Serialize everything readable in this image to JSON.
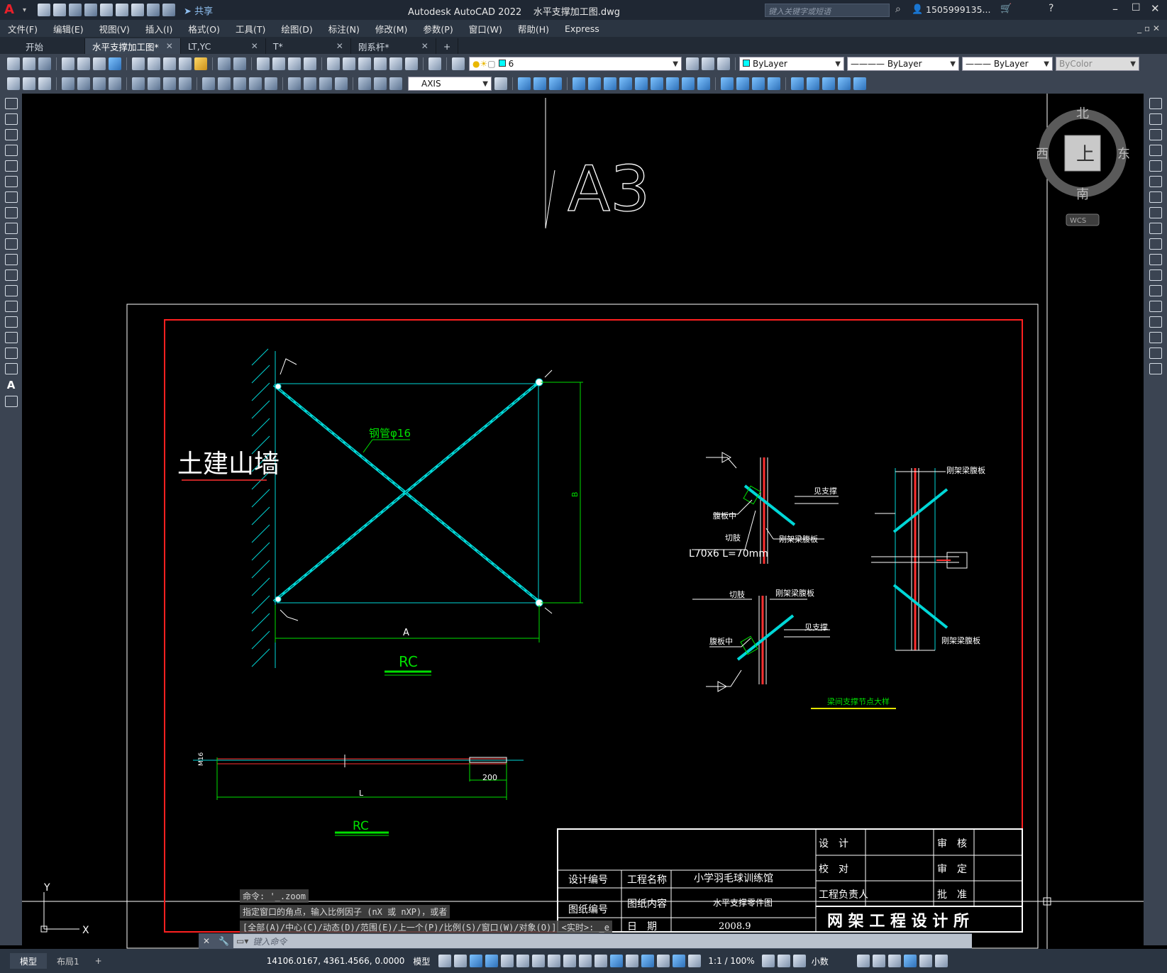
{
  "app": {
    "title": "Autodesk AutoCAD 2022",
    "document": "水平支撑加工图.dwg",
    "share_label": "共享",
    "search_placeholder": "键入关键字或短语",
    "user": "1505999135..."
  },
  "menu": [
    "文件(F)",
    "编辑(E)",
    "视图(V)",
    "插入(I)",
    "格式(O)",
    "工具(T)",
    "绘图(D)",
    "标注(N)",
    "修改(M)",
    "参数(P)",
    "窗口(W)",
    "帮助(H)",
    "Express"
  ],
  "tabs": [
    {
      "label": "开始",
      "closable": false
    },
    {
      "label": "水平支撑加工图*",
      "closable": true,
      "active": true
    },
    {
      "label": "LT,YC",
      "closable": true
    },
    {
      "label": "T*",
      "closable": true
    },
    {
      "label": "刚系杆*",
      "closable": true
    }
  ],
  "toolbar": {
    "layer_value": "6",
    "color_value": "ByLayer",
    "linetype_value": "ByLayer",
    "lineweight_value": "ByLayer",
    "plotstyle_value": "ByColor",
    "textstyle_value": "AXIS"
  },
  "viewcube": {
    "north": "北",
    "south": "南",
    "east": "东",
    "west": "西",
    "face": "上",
    "wcs": "WCS"
  },
  "drawing": {
    "sheet_label": "A3",
    "wall_label": "土建山墙",
    "pipe_label": "钢管φ16",
    "dim_a": "A",
    "dim_b": "B",
    "rc_label_1": "RC",
    "rc_label_2": "RC",
    "rod_dim_200": "200",
    "rod_dim_l": "L",
    "rod_end_label": "M16",
    "detail_labels": {
      "see_brace_1": "见支撑",
      "web_center_1": "腹板中",
      "cut_corner_1": "切肢",
      "frame_beam_web_1": "刚架梁腹板",
      "angle_label": "L70x6 L=70mm",
      "cut_corner_2": "切肢",
      "frame_beam_web_2": "刚架梁腹板",
      "see_brace_2": "见支撑",
      "web_center_2": "腹板中",
      "frame_beam_web_3": "刚架梁腹板",
      "frame_beam_web_4": "刚架梁腹板",
      "detail_title": "梁间支撑节点大样"
    },
    "titleblock": {
      "design": "设　计",
      "review": "审　核",
      "check": "校　对",
      "approve_set": "审　定",
      "project_lead": "工程负责人",
      "ratify": "批　准",
      "design_no": "设计编号",
      "project_name_label": "工程名称",
      "project_name": "小学羽毛球训练馆",
      "drawing_no": "图纸编号",
      "drawing_content_label": "图纸内容",
      "drawing_content": "水平支撑零件图",
      "date_label": "日　期",
      "date": "2008.9",
      "firm": "网 架 工 程 设 计 所"
    },
    "ucs_x": "X",
    "ucs_y": "Y"
  },
  "command": {
    "history": [
      "命令: '_.zoom",
      "指定窗口的角点，输入比例因子 (nX 或 nXP)，或者",
      "[全部(A)/中心(C)/动态(D)/范围(E)/上一个(P)/比例(S)/窗口(W)/对象(O)] <实时>: _e"
    ],
    "placeholder": "键入命令"
  },
  "layout_tabs": [
    "模型",
    "布局1"
  ],
  "status": {
    "coords": "14106.0167, 4361.4566, 0.0000",
    "model": "模型",
    "scale": "1:1 / 100%",
    "units": "小数"
  },
  "colors": {
    "cyan": "#00d7d7",
    "green": "#00e000",
    "red": "#ff2020",
    "white": "#ffffff",
    "yellow": "#e6e600"
  }
}
